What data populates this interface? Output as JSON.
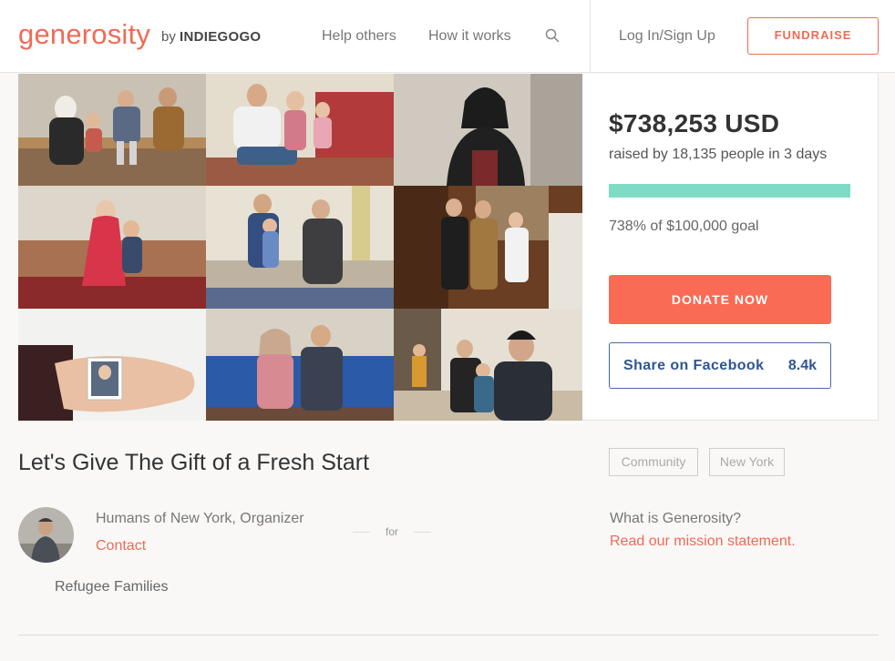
{
  "header": {
    "logo": "generosity",
    "logo_by": "by",
    "logo_brand": "INDIEGOGO",
    "nav": {
      "help": "Help others",
      "how": "How it works",
      "login": "Log In/Sign Up"
    },
    "fundraise_label": "FUNDRAISE",
    "icons": {
      "search": "search-icon"
    }
  },
  "campaign": {
    "amount": "$738,253 USD",
    "raised_by": "raised by 18,135 people in 3 days",
    "progress_fraction": 1.0,
    "goal_text": "738% of $100,000 goal",
    "donate_label": "DONATE NOW",
    "facebook_label": "Share on Facebook",
    "facebook_count": "8.4k",
    "title": "Let's Give The Gift of a Fresh Start",
    "tags": [
      "Community",
      "New York"
    ],
    "organizer": "Humans of New York, Organizer",
    "contact_label": "Contact",
    "for_label": "for",
    "beneficiary": "Refugee Families",
    "what_is": "What is Generosity?",
    "mission_link": "Read our mission statement."
  },
  "photos": [
    "family-photo-1",
    "family-photo-2",
    "family-photo-3",
    "family-photo-4",
    "family-photo-5",
    "family-photo-6",
    "family-photo-7",
    "family-photo-8",
    "family-photo-9"
  ],
  "colors": {
    "brand": "#f06a55",
    "donate": "#f96b54",
    "progress": "#7fdcc4",
    "facebook": "#2e5594"
  }
}
